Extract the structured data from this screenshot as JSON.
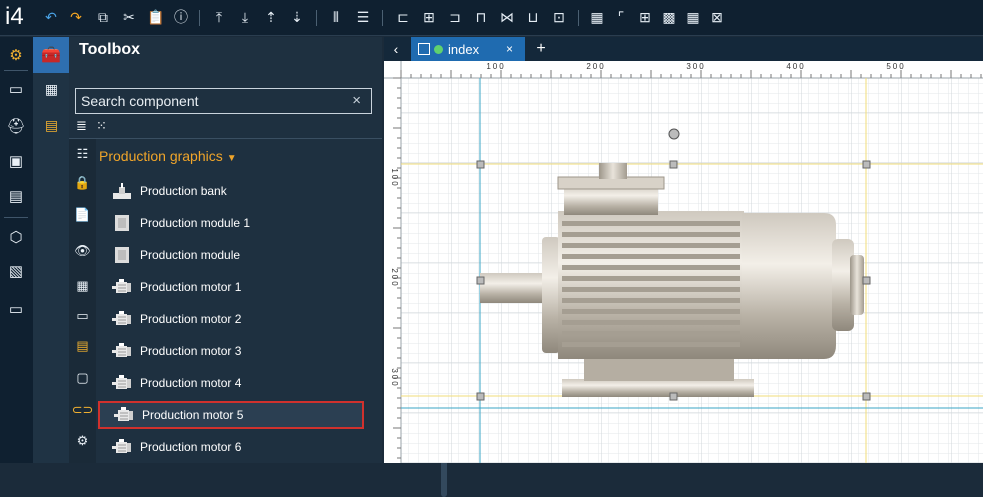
{
  "app": {
    "logo": "i4"
  },
  "toolbar": {
    "icons": [
      "undo-icon",
      "redo-icon",
      "copy-icon",
      "cut-icon",
      "paste-icon",
      "info-icon",
      "align-top-icon",
      "align-bottom-icon",
      "bring-forward-icon",
      "send-backward-icon",
      "distribute-h-icon",
      "distribute-v-icon",
      "align-left-icon",
      "align-center-icon",
      "align-right-icon",
      "align-top-edge-icon",
      "align-middle-icon",
      "align-bottom-edge-icon",
      "align-grid-icon",
      "grid-icon",
      "ruler-icon",
      "snap-grid-icon",
      "snap-objects-icon",
      "fit-icon"
    ]
  },
  "left_rail": {
    "icons": [
      "settings-icon",
      "dashboard-icon",
      "helmet-icon",
      "screen-icon",
      "server-icon",
      "package-icon",
      "monitor-settings-icon",
      "archive-icon"
    ]
  },
  "toolbox": {
    "title": "Toolbox",
    "search_placeholder": "Search component",
    "search_value": "Search component",
    "clear_glyph": "×",
    "group_title": "Production graphics",
    "items": [
      {
        "label": "Production bank",
        "icon": "production-bank-icon"
      },
      {
        "label": "Production module 1",
        "icon": "production-module-icon"
      },
      {
        "label": "Production module",
        "icon": "production-module-icon"
      },
      {
        "label": "Production motor 1",
        "icon": "motor-icon"
      },
      {
        "label": "Production motor 2",
        "icon": "motor-icon"
      },
      {
        "label": "Production motor 3",
        "icon": "motor-icon"
      },
      {
        "label": "Production motor 4",
        "icon": "motor-icon"
      },
      {
        "label": "Production motor 5",
        "icon": "motor-icon",
        "selected": true
      },
      {
        "label": "Production motor 6",
        "icon": "motor-icon"
      }
    ]
  },
  "tabs": {
    "back_glyph": "‹",
    "active_tab": {
      "label": "index",
      "status_color": "#5fd16f",
      "close_glyph": "×"
    },
    "add_glyph": "+"
  },
  "ruler": {
    "top_labels": [
      "100",
      "200",
      "300",
      "400",
      "500"
    ],
    "left_labels": [
      "100",
      "200",
      "300"
    ]
  },
  "colors": {
    "accent": "#2e6fb0",
    "group_title": "#f0a52a",
    "selection_border": "#d0312d",
    "guide_yellow": "#f2dd7a",
    "guide_cyan": "#3aa6c6"
  }
}
